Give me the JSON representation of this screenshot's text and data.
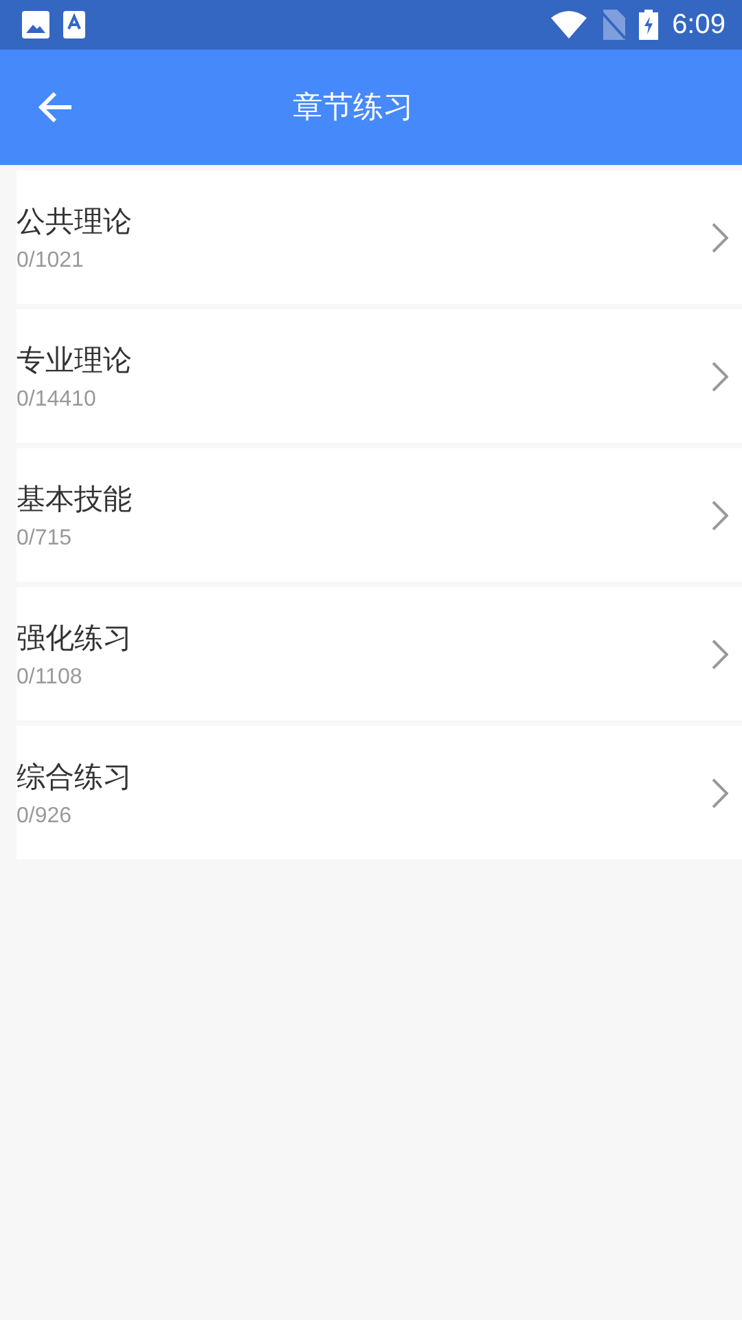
{
  "status_bar": {
    "time": "6:09"
  },
  "app_bar": {
    "title": "章节练习"
  },
  "chapters": [
    {
      "title": "公共理论",
      "progress": "0/1021"
    },
    {
      "title": "专业理论",
      "progress": "0/14410"
    },
    {
      "title": "基本技能",
      "progress": "0/715"
    },
    {
      "title": "强化练习",
      "progress": "0/1108"
    },
    {
      "title": "综合练习",
      "progress": "0/926"
    }
  ]
}
